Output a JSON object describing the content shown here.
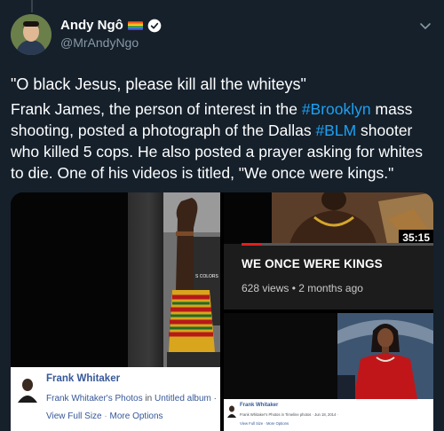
{
  "tweet": {
    "author_name": "Andy Ngô",
    "handle": "@MrAndyNgo",
    "quote": "\"O black Jesus, please kill all the whiteys\"",
    "body": {
      "part1": "Frank James, the person of interest in the ",
      "hashtag1": "#Brooklyn",
      "part2": " mass shooting, posted a photograph of the Dallas ",
      "hashtag2": "#BLM",
      "part3": " shooter who killed 5 cops. He also posted a prayer asking for whites to die. One of his videos is titled, \"We once were kings.\""
    }
  },
  "media": {
    "fb_left": {
      "name": "Frank Whitaker",
      "album_link1": "Frank Whitaker's Photos",
      "album_in": " in ",
      "album_link2": "Untitled album",
      "album_tail": " · ",
      "view_full": "View Full Size",
      "separator": " · ",
      "more_options": "More Options",
      "photo_caption": "S COLORS"
    },
    "video": {
      "duration": "35:15",
      "progress_fraction": 0.1,
      "title": "WE ONCE WERE KINGS",
      "meta": "628 views • 2 months ago"
    },
    "fb_right": {
      "name": "Frank Whitaker",
      "album": "Frank Whitaker's Photos in Timeline photos · Jun 18, 2014 ·",
      "links": "View Full Size · More Options"
    }
  },
  "colors": {
    "background": "#15202b",
    "hashtag": "#1da1f2",
    "secondary_text": "#8899a6",
    "verified": "#1da1f2",
    "progress": "#e31e1e"
  },
  "icons": [
    "rainbow-flag-icon",
    "verified-badge-icon",
    "chevron-down-icon"
  ]
}
